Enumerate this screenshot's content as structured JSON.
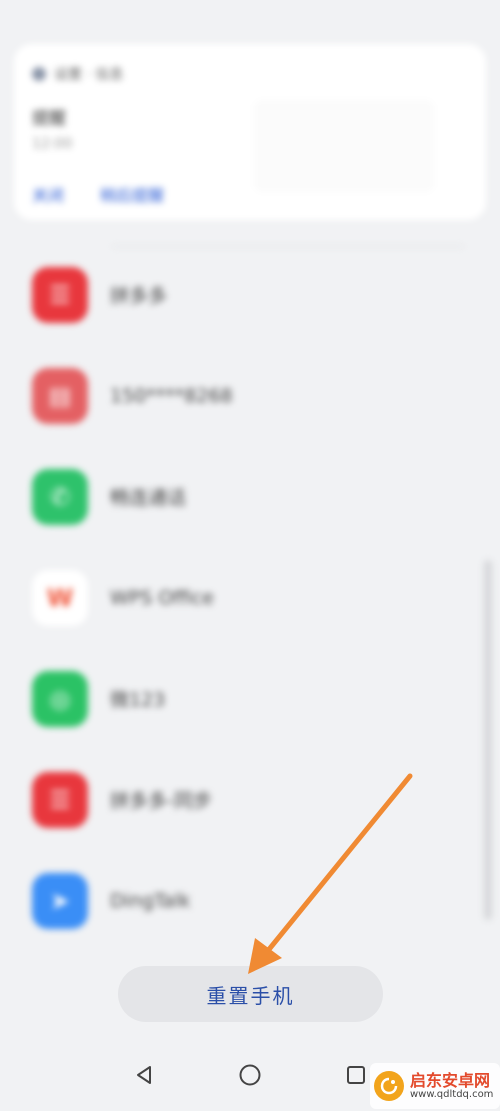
{
  "card": {
    "app": "设置 · 信息",
    "title": "提醒",
    "subtitle": "12:00",
    "actions": [
      "关闭",
      "稍后提醒"
    ]
  },
  "apps": [
    {
      "label": "拼多多",
      "color": "#e8373d",
      "icon": "shopping-bag-icon",
      "glyph": "☰"
    },
    {
      "label": "150****8268",
      "color": "#e46063",
      "icon": "sim-card-icon",
      "glyph": "▤"
    },
    {
      "label": "畅连通话",
      "color": "#2ec26b",
      "icon": "phone-icon",
      "glyph": "✆"
    },
    {
      "label": "WPS Office",
      "color": "#ffffff",
      "icon": "wps-icon",
      "glyph": "W"
    },
    {
      "label": "微123",
      "color": "#2bc265",
      "icon": "chat-icon",
      "glyph": "◎"
    },
    {
      "label": "拼多多-同步",
      "color": "#e8373d",
      "icon": "shopping-bag-icon",
      "glyph": "☰"
    },
    {
      "label": "DingTalk",
      "color": "#3a8ef6",
      "icon": "dingtalk-icon",
      "glyph": "➤"
    }
  ],
  "reset_button": "重置手机",
  "watermark": {
    "name": "启东安卓网",
    "url": "www.qdltdq.com"
  },
  "colors": {
    "accent": "#2b4fa8",
    "arrow": "#f08a33"
  }
}
